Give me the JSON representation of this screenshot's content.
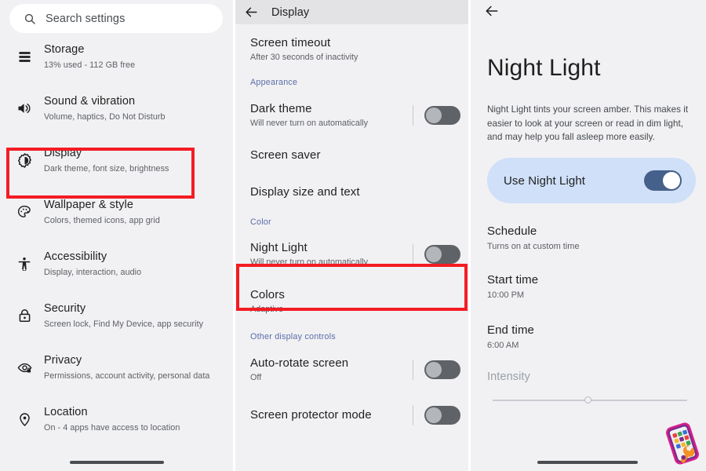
{
  "colors": {
    "panel_bg": "#f1f1f3",
    "highlight_red": "#f41c22",
    "section_label_blue": "#5b6ea8",
    "toggle_off_track": "#5f6267",
    "toggle_on_track": "#45608a",
    "card_blue": "#cfe0f8"
  },
  "left_panel": {
    "search": {
      "icon": "search-icon",
      "placeholder": "Search settings",
      "value": "Search settings"
    },
    "items": [
      {
        "icon": "storage-icon",
        "title": "Storage",
        "subtitle": "13% used - 112 GB free"
      },
      {
        "icon": "volume-icon",
        "title": "Sound & vibration",
        "subtitle": "Volume, haptics, Do Not Disturb"
      },
      {
        "icon": "brightness-icon",
        "title": "Display",
        "subtitle": "Dark theme, font size, brightness"
      },
      {
        "icon": "palette-icon",
        "title": "Wallpaper & style",
        "subtitle": "Colors, themed icons, app grid"
      },
      {
        "icon": "accessibility-icon",
        "title": "Accessibility",
        "subtitle": "Display, interaction, audio"
      },
      {
        "icon": "lock-icon",
        "title": "Security",
        "subtitle": "Screen lock, Find My Device, app security"
      },
      {
        "icon": "eye-icon",
        "title": "Privacy",
        "subtitle": "Permissions, account activity, personal data"
      },
      {
        "icon": "location-pin-icon",
        "title": "Location",
        "subtitle": "On - 4 apps have access to location"
      }
    ]
  },
  "middle_panel": {
    "header": {
      "back_icon": "back-arrow-icon",
      "title": "Display"
    },
    "rows": [
      {
        "type": "row",
        "title": "Screen timeout",
        "subtitle": "After 30 seconds of inactivity",
        "toggle": null
      },
      {
        "type": "section",
        "title": "Appearance"
      },
      {
        "type": "row",
        "title": "Dark theme",
        "subtitle": "Will never turn on automatically",
        "toggle": "off"
      },
      {
        "type": "row",
        "title": "Screen saver",
        "subtitle": "",
        "toggle": null
      },
      {
        "type": "row",
        "title": "Display size and text",
        "subtitle": "",
        "toggle": null
      },
      {
        "type": "section",
        "title": "Color"
      },
      {
        "type": "row",
        "title": "Night Light",
        "subtitle": "Will never turn on automatically",
        "toggle": "off"
      },
      {
        "type": "row",
        "title": "Colors",
        "subtitle": "Adaptive",
        "toggle": null
      },
      {
        "type": "section",
        "title": "Other display controls"
      },
      {
        "type": "row",
        "title": "Auto-rotate screen",
        "subtitle": "Off",
        "toggle": "off"
      },
      {
        "type": "row",
        "title": "Screen protector mode",
        "subtitle": "",
        "toggle": "off"
      }
    ]
  },
  "right_panel": {
    "back_icon": "back-arrow-icon",
    "title": "Night Light",
    "description": "Night Light tints your screen amber. This makes it easier to look at your screen or read in dim light, and may help you fall asleep more easily.",
    "use_night_light": {
      "label": "Use Night Light",
      "state": "on"
    },
    "schedule": {
      "title": "Schedule",
      "subtitle": "Turns on at custom time"
    },
    "start_time": {
      "title": "Start time",
      "subtitle": "10:00 PM"
    },
    "end_time": {
      "title": "End time",
      "subtitle": "6:00 AM"
    },
    "intensity": {
      "label": "Intensity",
      "value_percent": 47,
      "disabled": true
    }
  },
  "annotations": {
    "highlight_display": "Display",
    "highlight_night_light": "Night Light"
  },
  "watermark": {
    "name": "phone-wrench-logo"
  }
}
